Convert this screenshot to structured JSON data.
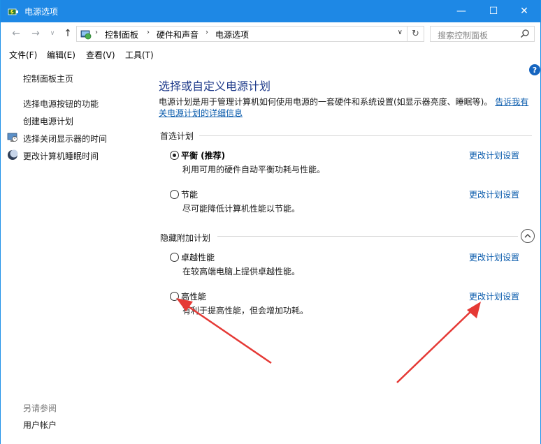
{
  "window": {
    "title": "电源选项",
    "minimize_glyph": "—",
    "maximize_glyph": "☐",
    "close_glyph": "✕"
  },
  "nav": {
    "back_glyph": "←",
    "forward_glyph": "→",
    "recent_glyph": "∨",
    "up_glyph": "↑",
    "breadcrumbs": [
      "控制面板",
      "硬件和声音",
      "电源选项"
    ],
    "separator": "›",
    "dropdown_glyph": "∨",
    "refresh_glyph": "↻",
    "search_placeholder": "搜索控制面板"
  },
  "menu": {
    "items": [
      "文件(F)",
      "编辑(E)",
      "查看(V)",
      "工具(T)"
    ]
  },
  "sidebar": {
    "home": "控制面板主页",
    "links": [
      "选择电源按钮的功能",
      "创建电源计划",
      "选择关闭显示器的时间",
      "更改计算机睡眠时间"
    ],
    "see_also": "另请参阅",
    "footer_link": "用户帐户"
  },
  "main": {
    "help_glyph": "?",
    "title": "选择或自定义电源计划",
    "description": "电源计划是用于管理计算机如何使用电源的一套硬件和系统设置(如显示器亮度、睡眠等)。",
    "description_link": "告诉我有关电源计划的详细信息",
    "preferred_section": "首选计划",
    "hidden_section": "隐藏附加计划",
    "plans": [
      {
        "name": "平衡 (推荐)",
        "desc": "利用可用的硬件自动平衡功耗与性能。",
        "selected": true,
        "link": "更改计划设置"
      },
      {
        "name": "节能",
        "desc": "尽可能降低计算机性能以节能。",
        "selected": false,
        "link": "更改计划设置"
      },
      {
        "name": "卓越性能",
        "desc": "在较高端电脑上提供卓越性能。",
        "selected": false,
        "link": "更改计划设置"
      },
      {
        "name": "高性能",
        "desc": "有利于提高性能，但会增加功耗。",
        "selected": false,
        "link": "更改计划设置"
      }
    ]
  },
  "colors": {
    "titlebar": "#1e88e5",
    "link": "#0b5cad",
    "title_text": "#1e3a8a",
    "annotation_arrow": "#e53935"
  }
}
